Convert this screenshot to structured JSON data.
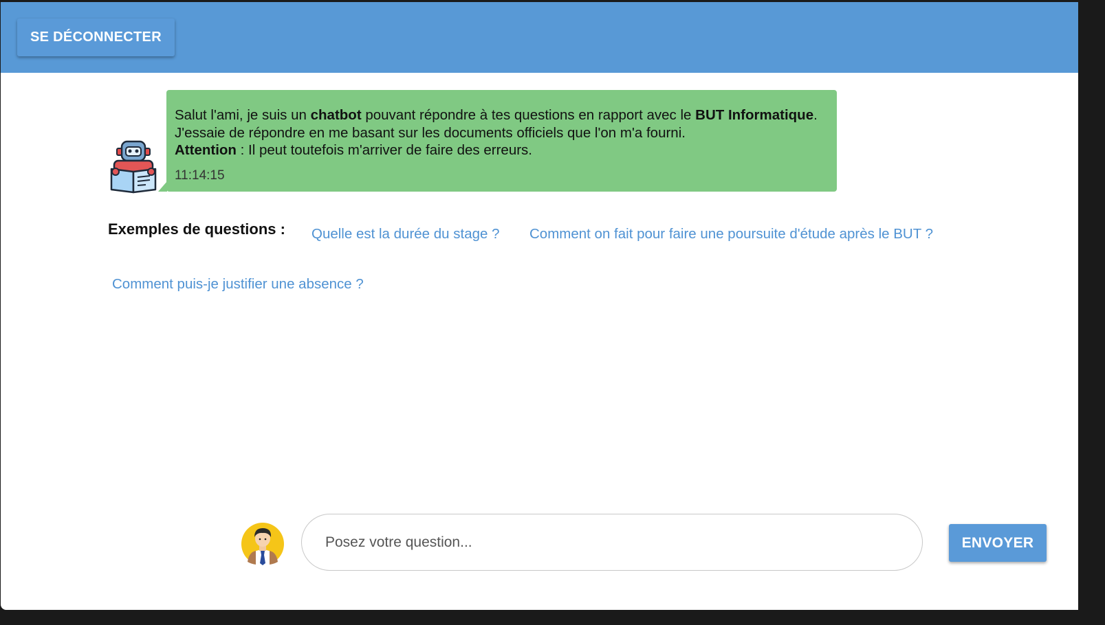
{
  "header": {
    "logout_label": "SE DÉCONNECTER"
  },
  "bot_message": {
    "greeting_pre": "Salut l'ami, je suis un ",
    "greeting_bold1": "chatbot",
    "greeting_mid": " pouvant répondre à tes questions en rapport avec le ",
    "greeting_bold2": "BUT Informatique",
    "greeting_end": ".",
    "line2": "J'essaie de répondre en me basant sur les documents officiels que l'on m'a fourni.",
    "attention_label": "Attention",
    "attention_text": " : Il peut toutefois m'arriver de faire des erreurs.",
    "time": "11:14:15"
  },
  "examples": {
    "title": "Exemples de questions :",
    "items": [
      "Quelle est la durée du stage ?",
      "Comment on fait pour faire une poursuite d'étude après le BUT ?",
      "Comment puis-je justifier une absence ?"
    ]
  },
  "composer": {
    "placeholder": "Posez votre question...",
    "send_label": "ENVOYER"
  },
  "colors": {
    "header_bg": "#5899d6",
    "button_bg": "#5a9ad8",
    "bot_bubble": "#80c983",
    "link": "#4f92d3"
  },
  "icons": {
    "bot_avatar": "robot-reading-icon",
    "user_avatar": "user-avatar-icon"
  }
}
